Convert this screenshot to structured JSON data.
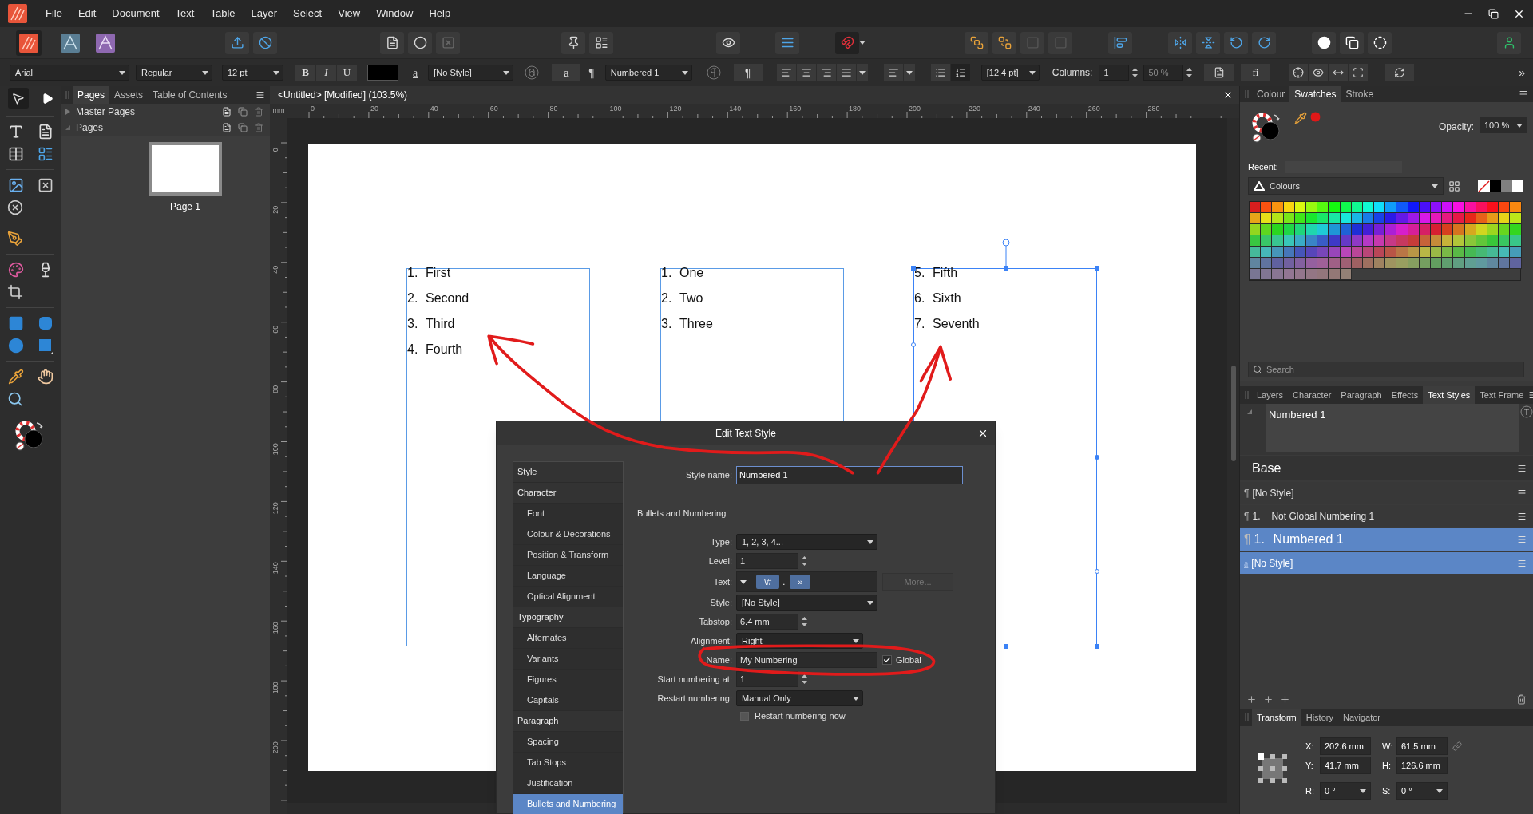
{
  "menu_bar": {
    "items": [
      "File",
      "Edit",
      "Document",
      "Text",
      "Table",
      "Layer",
      "Select",
      "View",
      "Window",
      "Help"
    ]
  },
  "context_toolbar": {
    "font": "Arial",
    "font_style": "Regular",
    "font_size": "12 pt",
    "bold": "B",
    "italic": "I",
    "underline": "U",
    "character_glyph": "a",
    "character_style": "[No Style]",
    "character_button": "a",
    "paragraph_glyph": "¶",
    "paragraph_style": "Numbered 1",
    "paragraph_button": "¶",
    "leading": "[12.4 pt]",
    "columns_label": "Columns:",
    "columns": "1",
    "gutter": "50 %",
    "ligature_button": "fi",
    "overflow": "»"
  },
  "pages_panel": {
    "tabs": [
      {
        "label": "Pages",
        "selected": true
      },
      {
        "label": "Assets",
        "selected": false
      },
      {
        "label": "Table of Contents",
        "selected": false
      }
    ],
    "sections": [
      {
        "label": "Master Pages",
        "expanded": false
      },
      {
        "label": "Pages",
        "expanded": true
      }
    ],
    "pages": [
      {
        "label": "Page 1"
      }
    ]
  },
  "document": {
    "title": "<Untitled> [Modified] (103.5%)",
    "ruler_unit": "mm",
    "h_ruler": [
      "0",
      "20",
      "40",
      "60",
      "80",
      "100",
      "120",
      "140",
      "160",
      "180",
      "200",
      "220",
      "240",
      "260",
      "280"
    ],
    "v_ruler": [
      "0",
      "20",
      "40",
      "60",
      "80",
      "100",
      "120",
      "140",
      "160",
      "180",
      "200"
    ],
    "text_frames": [
      {
        "selected": false,
        "items": [
          {
            "number": "1.",
            "text": "First"
          },
          {
            "number": "2.",
            "text": "Second"
          },
          {
            "number": "3.",
            "text": "Third"
          },
          {
            "number": "4.",
            "text": "Fourth"
          }
        ]
      },
      {
        "selected": false,
        "items": [
          {
            "number": "1.",
            "text": "One"
          },
          {
            "number": "2.",
            "text": "Two"
          },
          {
            "number": "3.",
            "text": "Three"
          }
        ]
      },
      {
        "selected": true,
        "items": [
          {
            "number": "5.",
            "text": "Fifth"
          },
          {
            "number": "6.",
            "text": "Sixth"
          },
          {
            "number": "7.",
            "text": "Seventh"
          }
        ]
      }
    ]
  },
  "dialog": {
    "title": "Edit Text Style",
    "nav": [
      {
        "label": "Style",
        "kind": "heading",
        "selected": false
      },
      {
        "label": "Character",
        "kind": "heading",
        "selected": false
      },
      {
        "label": "Font",
        "kind": "sub",
        "selected": false
      },
      {
        "label": "Colour & Decorations",
        "kind": "sub",
        "selected": false
      },
      {
        "label": "Position & Transform",
        "kind": "sub",
        "selected": false
      },
      {
        "label": "Language",
        "kind": "sub",
        "selected": false
      },
      {
        "label": "Optical Alignment",
        "kind": "sub",
        "selected": false
      },
      {
        "label": "Typography",
        "kind": "heading",
        "selected": false
      },
      {
        "label": "Alternates",
        "kind": "sub",
        "selected": false
      },
      {
        "label": "Variants",
        "kind": "sub",
        "selected": false
      },
      {
        "label": "Figures",
        "kind": "sub",
        "selected": false
      },
      {
        "label": "Capitals",
        "kind": "sub",
        "selected": false
      },
      {
        "label": "Paragraph",
        "kind": "heading",
        "selected": false
      },
      {
        "label": "Spacing",
        "kind": "sub",
        "selected": false
      },
      {
        "label": "Tab Stops",
        "kind": "sub",
        "selected": false
      },
      {
        "label": "Justification",
        "kind": "sub",
        "selected": false
      },
      {
        "label": "Bullets and Numbering",
        "kind": "sub",
        "selected": true
      }
    ],
    "style_name_label": "Style name:",
    "style_name": "Numbered 1",
    "section_title": "Bullets and Numbering",
    "type": {
      "label": "Type:",
      "value": "1, 2, 3, 4..."
    },
    "level": {
      "label": "Level:",
      "value": "1"
    },
    "text": {
      "label": "Text:",
      "tokens": [
        {
          "kind": "field",
          "text": "\\#"
        },
        {
          "kind": "literal",
          "text": "."
        },
        {
          "kind": "field",
          "text": "»"
        }
      ],
      "more": "More...",
      "more_disabled": true
    },
    "style": {
      "label": "Style:",
      "value": "[No Style]"
    },
    "tabstop": {
      "label": "Tabstop:",
      "value": "6.4 mm"
    },
    "alignment": {
      "label": "Alignment:",
      "value": "Right"
    },
    "name": {
      "label": "Name:",
      "value": "My Numbering",
      "global_label": "Global",
      "global": true
    },
    "start": {
      "label": "Start numbering at:",
      "value": "1"
    },
    "restart": {
      "label": "Restart numbering:",
      "value": "Manual Only"
    },
    "restart_now": {
      "label": "Restart numbering now",
      "checked": false
    }
  },
  "swatches_panel": {
    "tabs": [
      {
        "label": "Colour",
        "selected": false
      },
      {
        "label": "Swatches",
        "selected": true
      },
      {
        "label": "Stroke",
        "selected": false
      }
    ],
    "opacity_label": "Opacity:",
    "opacity": "100 %",
    "recent_label": "Recent:",
    "palette": "Colours",
    "search_placeholder": "Search"
  },
  "text_styles_panel": {
    "tabs": [
      {
        "label": "Layers",
        "selected": false
      },
      {
        "label": "Character",
        "selected": false
      },
      {
        "label": "Paragraph",
        "selected": false
      },
      {
        "label": "Effects",
        "selected": false
      },
      {
        "label": "Text Styles",
        "selected": true
      },
      {
        "label": "Text Frame",
        "selected": false
      }
    ],
    "preview": "Numbered 1",
    "group": "Base",
    "styles": [
      {
        "kind": "paragraph",
        "glyph": "¶",
        "label": "[No Style]",
        "selected": false,
        "active": false
      },
      {
        "kind": "paragraph",
        "glyph": "¶",
        "number": "1.",
        "label": "Not Global Numbering 1",
        "selected": false,
        "active": false
      },
      {
        "kind": "paragraph",
        "glyph": "¶",
        "number": "1.",
        "label": "Numbered 1",
        "selected": true,
        "active": true
      },
      {
        "kind": "character",
        "glyph": "a",
        "label": "[No Style]",
        "selected": true,
        "active": false
      }
    ]
  },
  "transform_panel": {
    "tabs": [
      {
        "label": "Transform",
        "selected": true
      },
      {
        "label": "History",
        "selected": false
      },
      {
        "label": "Navigator",
        "selected": false
      }
    ],
    "rows": [
      [
        {
          "kind": "input",
          "label": "X:",
          "value": "202.6 mm"
        },
        {
          "kind": "input",
          "label": "W:",
          "value": "61.5 mm"
        }
      ],
      [
        {
          "kind": "input",
          "label": "Y:",
          "value": "41.7 mm"
        },
        {
          "kind": "input",
          "label": "H:",
          "value": "126.6 mm"
        }
      ],
      [
        {
          "kind": "dropdown",
          "label": "R:",
          "value": "0 °"
        },
        {
          "kind": "dropdown",
          "label": "S:",
          "value": "0 °"
        }
      ]
    ]
  }
}
